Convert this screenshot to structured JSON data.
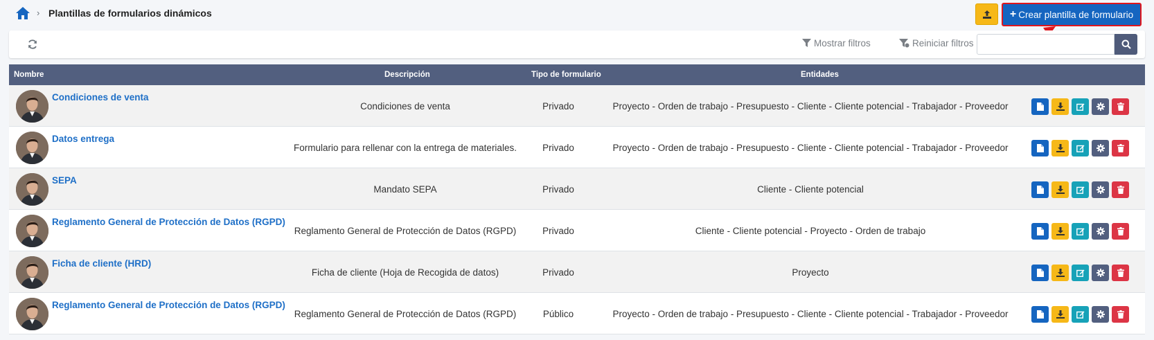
{
  "header": {
    "title": "Plantillas de formularios dinámicos",
    "create_label": "Crear plantilla de formulario",
    "create_plus": "+"
  },
  "toolbar": {
    "show_filters": "Mostrar filtros",
    "reset_filters": "Reiniciar filtros",
    "search_value": ""
  },
  "table": {
    "headers": {
      "name": "Nombre",
      "description": "Descripción",
      "type": "Tipo de formulario",
      "entities": "Entidades"
    },
    "rows": [
      {
        "name": "Condiciones de venta",
        "description": "Condiciones de venta",
        "type": "Privado",
        "entities": "Proyecto - Orden de trabajo - Presupuesto - Cliente - Cliente potencial - Trabajador - Proveedor"
      },
      {
        "name": "Datos entrega",
        "description": "Formulario para rellenar con la entrega de materiales.",
        "type": "Privado",
        "entities": "Proyecto - Orden de trabajo - Presupuesto - Cliente - Cliente potencial - Trabajador - Proveedor"
      },
      {
        "name": "SEPA",
        "description": "Mandato SEPA",
        "type": "Privado",
        "entities": "Cliente - Cliente potencial"
      },
      {
        "name": "Reglamento General de Protección de Datos (RGPD)",
        "description": "Reglamento General de Protección de Datos (RGPD)",
        "type": "Privado",
        "entities": "Cliente - Cliente potencial - Proyecto - Orden de trabajo"
      },
      {
        "name": "Ficha de cliente (HRD)",
        "description": "Ficha de cliente (Hoja de Recogida de datos)",
        "type": "Privado",
        "entities": "Proyecto"
      },
      {
        "name": "Reglamento General de Protección de Datos (RGPD)",
        "description": "Reglamento General de Protección de Datos (RGPD)",
        "type": "Público",
        "entities": "Proyecto - Orden de trabajo - Presupuesto - Cliente - Cliente potencial - Trabajador - Proveedor"
      }
    ]
  },
  "colors": {
    "primary": "#1565c0",
    "warning": "#f6b818",
    "info": "#17a2b8",
    "secondary": "#525f7f",
    "danger": "#dc3545",
    "highlight": "#e0161d"
  },
  "icons": [
    "home-icon",
    "upload-icon",
    "refresh-icon",
    "filter-icon",
    "filter-reset-icon",
    "search-icon",
    "document-icon",
    "download-icon",
    "edit-icon",
    "gear-icon",
    "trash-icon"
  ]
}
